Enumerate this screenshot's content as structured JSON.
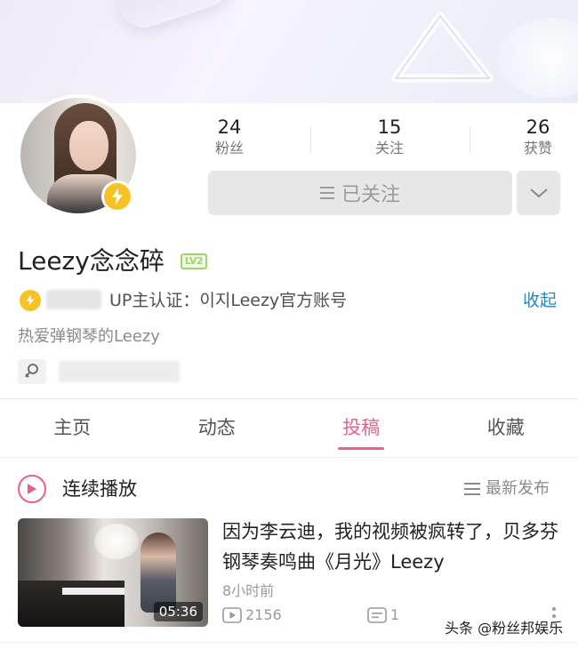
{
  "stats": [
    {
      "value": "24",
      "label": "粉丝"
    },
    {
      "value": "15",
      "label": "关注"
    },
    {
      "value": "26",
      "label": "获赞"
    }
  ],
  "follow_button": {
    "label": "已关注"
  },
  "profile": {
    "name": "Leezy念念碎",
    "level": "LV2",
    "certification": "UP主认证：이지Leezy官方账号",
    "collapse_label": "收起",
    "bio": "热爱弹钢琴的Leezy"
  },
  "tabs": [
    {
      "label": "主页",
      "active": false
    },
    {
      "label": "动态",
      "active": false
    },
    {
      "label": "投稿",
      "active": true
    },
    {
      "label": "收藏",
      "active": false
    }
  ],
  "playlist": {
    "continuous_label": "连续播放",
    "sort_label": "最新发布"
  },
  "video": {
    "title": "因为李云迪，我的视频被疯转了，贝多芬钢琴奏鸣曲《月光》Leezy",
    "duration": "05:36",
    "time_ago": "8小时前",
    "views": "2156",
    "danmaku": "1"
  },
  "watermark": "头条 @粉丝邦娱乐",
  "colors": {
    "accent_pink": "#ec5e8e",
    "link_blue": "#2a86c2",
    "badge_yellow": "#f6c224",
    "level_green": "#9fd46c"
  },
  "icons": [
    "lightning-icon",
    "menu-lines-icon",
    "chevron-down-icon",
    "gender-icon",
    "play-circle-icon",
    "sort-lines-icon",
    "video-play-icon",
    "danmaku-icon",
    "kebab-icon"
  ]
}
